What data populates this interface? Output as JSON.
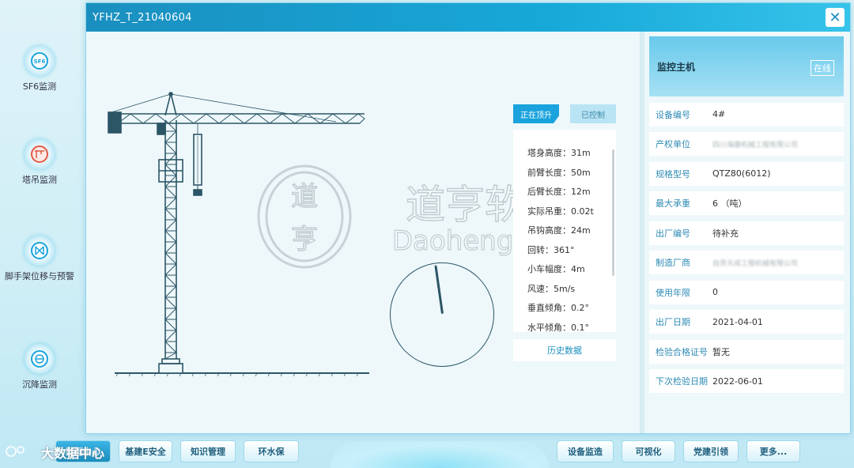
{
  "modal": {
    "title": "YFHZ_T_21040604",
    "close": "✕"
  },
  "sidebar": {
    "items": [
      {
        "label": "SF6监测",
        "icon": "sf6-icon"
      },
      {
        "label": "塔吊监测",
        "icon": "tower-crane-icon"
      },
      {
        "label": "脚手架位移与预警",
        "icon": "scaffold-icon"
      },
      {
        "label": "沉降监测",
        "icon": "settlement-icon"
      }
    ]
  },
  "status_tabs": {
    "active": "正在顶升",
    "inactive": "已控制"
  },
  "params": [
    "塔身高度：31m",
    "前臂长度：50m",
    "后臂长度：12m",
    "实际吊重：0.02t",
    "吊钩高度：24m",
    "回转：361°",
    "小车幅度：4m",
    "风速：5m/s",
    "垂直倾角：0.2°",
    "水平倾角：0.1°"
  ],
  "history_button": "历史数据",
  "watermark": {
    "line1": "道亨软件",
    "line2": "Daoheng INC.",
    "seal1": "道",
    "seal2": "亨"
  },
  "info": {
    "title": "监控主机",
    "status": "在线",
    "rows": [
      {
        "key": "设备编号",
        "value": "4#"
      },
      {
        "key": "产权单位",
        "value": "四川海康机械工程有限公司"
      },
      {
        "key": "规格型号",
        "value": "QTZ80(6012)"
      },
      {
        "key": "最大承重",
        "value": "6 （吨）"
      },
      {
        "key": "出厂编号",
        "value": "待补充"
      },
      {
        "key": "制造厂商",
        "value": "自贡天成工程机械有限公司"
      },
      {
        "key": "使用年限",
        "value": "0"
      },
      {
        "key": "出厂日期",
        "value": "2021-04-01"
      },
      {
        "key": "检验合格证号",
        "value": "暂无"
      },
      {
        "key": "下次检验日期",
        "value": "2022-06-01"
      }
    ]
  },
  "bottom_nav": {
    "brand": "大数据中心",
    "left": [
      "数据中心",
      "基建E安全",
      "知识管理",
      "环水保"
    ],
    "right": [
      "设备监造",
      "可视化",
      "党建引领",
      "更多..."
    ]
  },
  "colors": {
    "accent": "#1aa3dc",
    "header": "#1a8fbf",
    "crane": "#2c5566"
  }
}
